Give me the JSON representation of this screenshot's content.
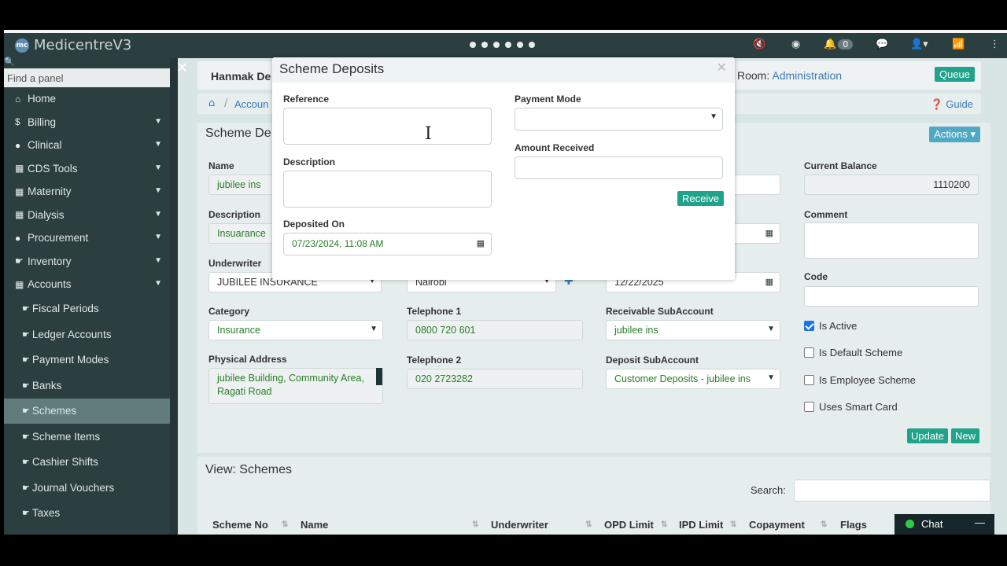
{
  "app": {
    "name": "MedicentreV3",
    "logo_text": "mc",
    "notifications": "0"
  },
  "icons": [
    "mic-off-icon",
    "user-circle-icon",
    "bell-icon",
    "chat-icon",
    "user-icon",
    "wifi-icon",
    "more-icon"
  ],
  "sidebar": {
    "search_placeholder": "Find a panel",
    "items": [
      {
        "label": "Home",
        "icon": "home-icon"
      },
      {
        "label": "Billing",
        "icon": "dollar-icon"
      },
      {
        "label": "Clinical",
        "icon": "user-icon"
      },
      {
        "label": "CDS Tools",
        "icon": "calendar-icon"
      },
      {
        "label": "Maternity",
        "icon": "calendar-icon"
      },
      {
        "label": "Dialysis",
        "icon": "calendar-icon"
      },
      {
        "label": "Procurement",
        "icon": "user-icon"
      },
      {
        "label": "Inventory",
        "icon": "thumb-icon"
      },
      {
        "label": "Accounts",
        "icon": "calendar-icon"
      }
    ],
    "sub_items": [
      "Fiscal Periods",
      "Ledger Accounts",
      "Payment Modes",
      "Banks",
      "Schemes",
      "Scheme Items",
      "Cashier Shifts",
      "Journal Vouchers",
      "Taxes"
    ],
    "active_sub": "Schemes"
  },
  "header": {
    "title": "Hanmak De",
    "room_label": "Room:",
    "room_value": "Administration",
    "queue": "Queue",
    "breadcrumb": "Accoun",
    "guide": "Guide"
  },
  "form": {
    "title": "Scheme De",
    "actions": "Actions",
    "name_label": "Name",
    "name_value": "jubilee ins",
    "description_label": "Description",
    "description_value": "Insuarance",
    "underwriter_label": "Underwriter",
    "underwriter_value": "JUBILEE INSURANCE",
    "city_value": "Nairobi",
    "expiry_value": "12/22/2025",
    "category_label": "Category",
    "category_value": "Insurance",
    "tel1_label": "Telephone 1",
    "tel1_value": "0800 720 601",
    "receivable_label": "Receivable SubAccount",
    "receivable_value": "jubilee ins",
    "address_label": "Physical Address",
    "address_value": "jubilee Building, Community Area, Ragati Road",
    "tel2_label": "Telephone 2",
    "tel2_value": "020 2723282",
    "deposit_label": "Deposit SubAccount",
    "deposit_value": "Customer Deposits - jubilee ins",
    "balance_label": "Current Balance",
    "balance_value": "1110200",
    "comment_label": "Comment",
    "code_label": "Code",
    "is_active": "Is Active",
    "is_default": "Is Default Scheme",
    "is_employee": "Is Employee Scheme",
    "smart_card": "Uses Smart Card",
    "update": "Update",
    "new": "New"
  },
  "view": {
    "title": "View: Schemes",
    "search_label": "Search:",
    "columns": [
      "Scheme No",
      "Name",
      "Underwriter",
      "OPD Limit",
      "IPD Limit",
      "Copayment",
      "Flags"
    ]
  },
  "chat": {
    "label": "Chat"
  },
  "modal": {
    "title": "Scheme Deposits",
    "reference_label": "Reference",
    "description_label": "Description",
    "deposited_label": "Deposited On",
    "deposited_value": "07/23/2024, 11:08 AM",
    "payment_label": "Payment Mode",
    "amount_label": "Amount Received",
    "receive": "Receive"
  }
}
